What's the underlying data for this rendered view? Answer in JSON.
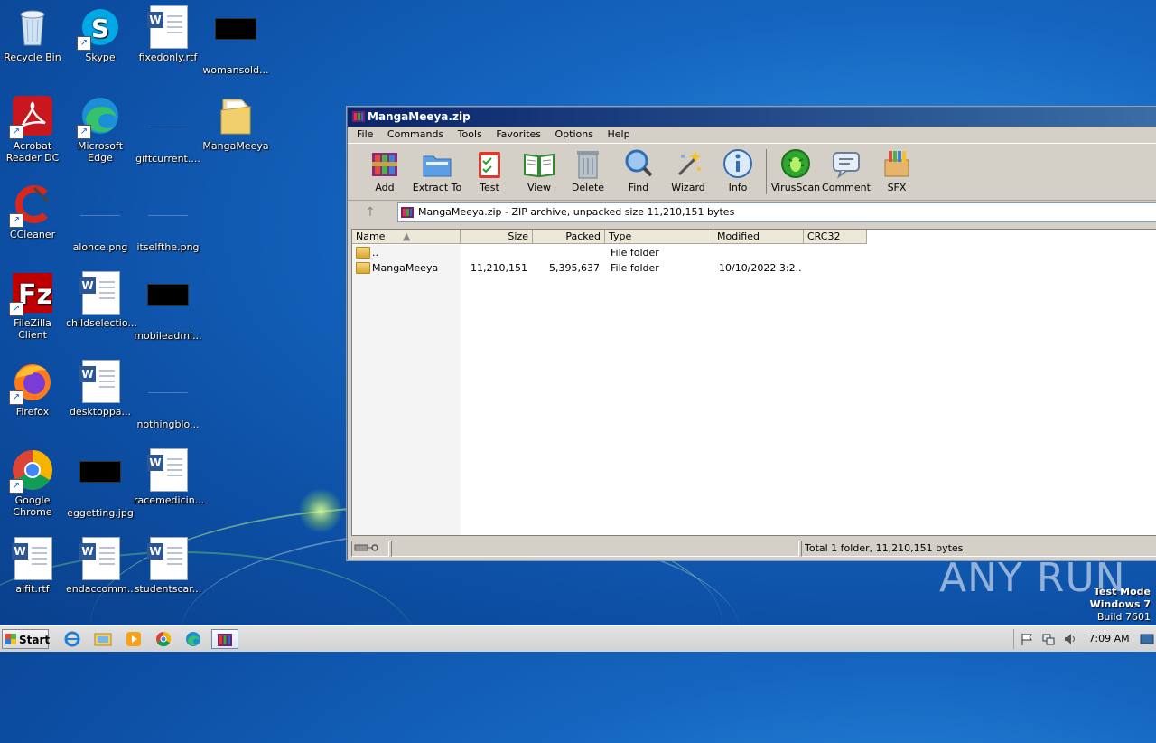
{
  "desktop": {
    "icons": [
      {
        "label": "Recycle Bin",
        "icon": "recycle-bin-icon"
      },
      {
        "label": "Skype",
        "icon": "skype-icon"
      },
      {
        "label": "fixedonly.rtf",
        "icon": "word-document-icon"
      },
      {
        "label": "womansold...",
        "icon": "black-image-thumbnail"
      },
      {
        "label": "Acrobat Reader DC",
        "icon": "acrobat-icon"
      },
      {
        "label": "Microsoft Edge",
        "icon": "edge-icon"
      },
      {
        "label": "giftcurrent....",
        "icon": "blank-file-icon"
      },
      {
        "label": "MangaMeeya",
        "icon": "folder-icon"
      },
      {
        "label": "CCleaner",
        "icon": "ccleaner-icon"
      },
      {
        "label": "alonce.png",
        "icon": "image-file-icon"
      },
      {
        "label": "itselfthe.png",
        "icon": "image-file-icon"
      },
      {
        "label": "FileZilla Client",
        "icon": "filezilla-icon"
      },
      {
        "label": "childselectio...",
        "icon": "word-document-icon"
      },
      {
        "label": "mobileadmi...",
        "icon": "black-image-thumbnail"
      },
      {
        "label": "Firefox",
        "icon": "firefox-icon"
      },
      {
        "label": "desktoppa...",
        "icon": "word-document-icon"
      },
      {
        "label": "nothingblo...",
        "icon": "image-file-icon"
      },
      {
        "label": "Google Chrome",
        "icon": "chrome-icon"
      },
      {
        "label": "eggetting.jpg",
        "icon": "black-image-thumbnail"
      },
      {
        "label": "racemedicin...",
        "icon": "word-document-icon"
      },
      {
        "label": "alfit.rtf",
        "icon": "word-document-icon"
      },
      {
        "label": "endaccomm...",
        "icon": "word-document-icon"
      },
      {
        "label": "studentscar...",
        "icon": "word-document-icon"
      }
    ]
  },
  "window": {
    "title": "MangaMeeya.zip",
    "menu": [
      "File",
      "Commands",
      "Tools",
      "Favorites",
      "Options",
      "Help"
    ],
    "toolbar": [
      "Add",
      "Extract To",
      "Test",
      "View",
      "Delete",
      "Find",
      "Wizard",
      "Info",
      "VirusScan",
      "Comment",
      "SFX"
    ],
    "address": "MangaMeeya.zip - ZIP archive, unpacked size 11,210,151 bytes",
    "columns": [
      "Name",
      "Size",
      "Packed",
      "Type",
      "Modified",
      "CRC32"
    ],
    "rows": [
      {
        "name": "..",
        "size": "",
        "packed": "",
        "type": "File folder",
        "modified": "",
        "crc": ""
      },
      {
        "name": "MangaMeeya",
        "size": "11,210,151",
        "packed": "5,395,637",
        "type": "File folder",
        "modified": "10/10/2022 3:2...",
        "crc": ""
      }
    ],
    "status_right": "Total 1 folder, 11,210,151 bytes"
  },
  "watermark": {
    "brand": "ANY RUN",
    "testmode": "Test Mode",
    "os": "Windows 7",
    "build": "Build 7601"
  },
  "taskbar": {
    "start": "Start",
    "clock": "7:09 AM"
  }
}
